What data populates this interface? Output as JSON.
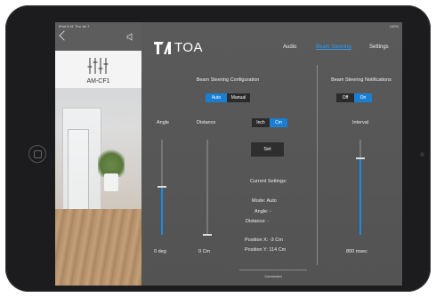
{
  "status_bar": {
    "left": "iPad 9:41  Thu Jul 7",
    "right": "100%"
  },
  "device": {
    "name": "AM-CF1"
  },
  "brand": {
    "name": "TOA"
  },
  "nav": {
    "audio": "Audio",
    "beam_steering": "Beam Steering",
    "settings": "Settings"
  },
  "config": {
    "title": "Beam Steering Configuration",
    "mode_auto": "Auto",
    "mode_manual": "Manual",
    "angle_label": "Angle",
    "distance_label": "Distance",
    "unit_inch": "Inch",
    "unit_cm": "Cm",
    "set_button": "Set",
    "angle_value": "0 deg",
    "distance_value": "0 Cm",
    "angle_slider_fraction": 0.5,
    "distance_slider_fraction": 0.0
  },
  "current": {
    "heading": "Current Settings:",
    "mode": "Mode: Auto",
    "angle": "Angle: -",
    "distance": "Distance: -",
    "position_x": "Position X: -3 Cm",
    "position_y": "Position Y: 114 Cm"
  },
  "notifications": {
    "title": "Beam Steering Notifications",
    "off": "Off",
    "on": "On",
    "interval_label": "Interval",
    "interval_value": "800 msec",
    "interval_slider_fraction": 0.8
  },
  "footer": {
    "status": "Connected"
  },
  "colors": {
    "accent": "#1a8ae6",
    "panel": "#565656",
    "dark_button": "#2b2b2b"
  }
}
